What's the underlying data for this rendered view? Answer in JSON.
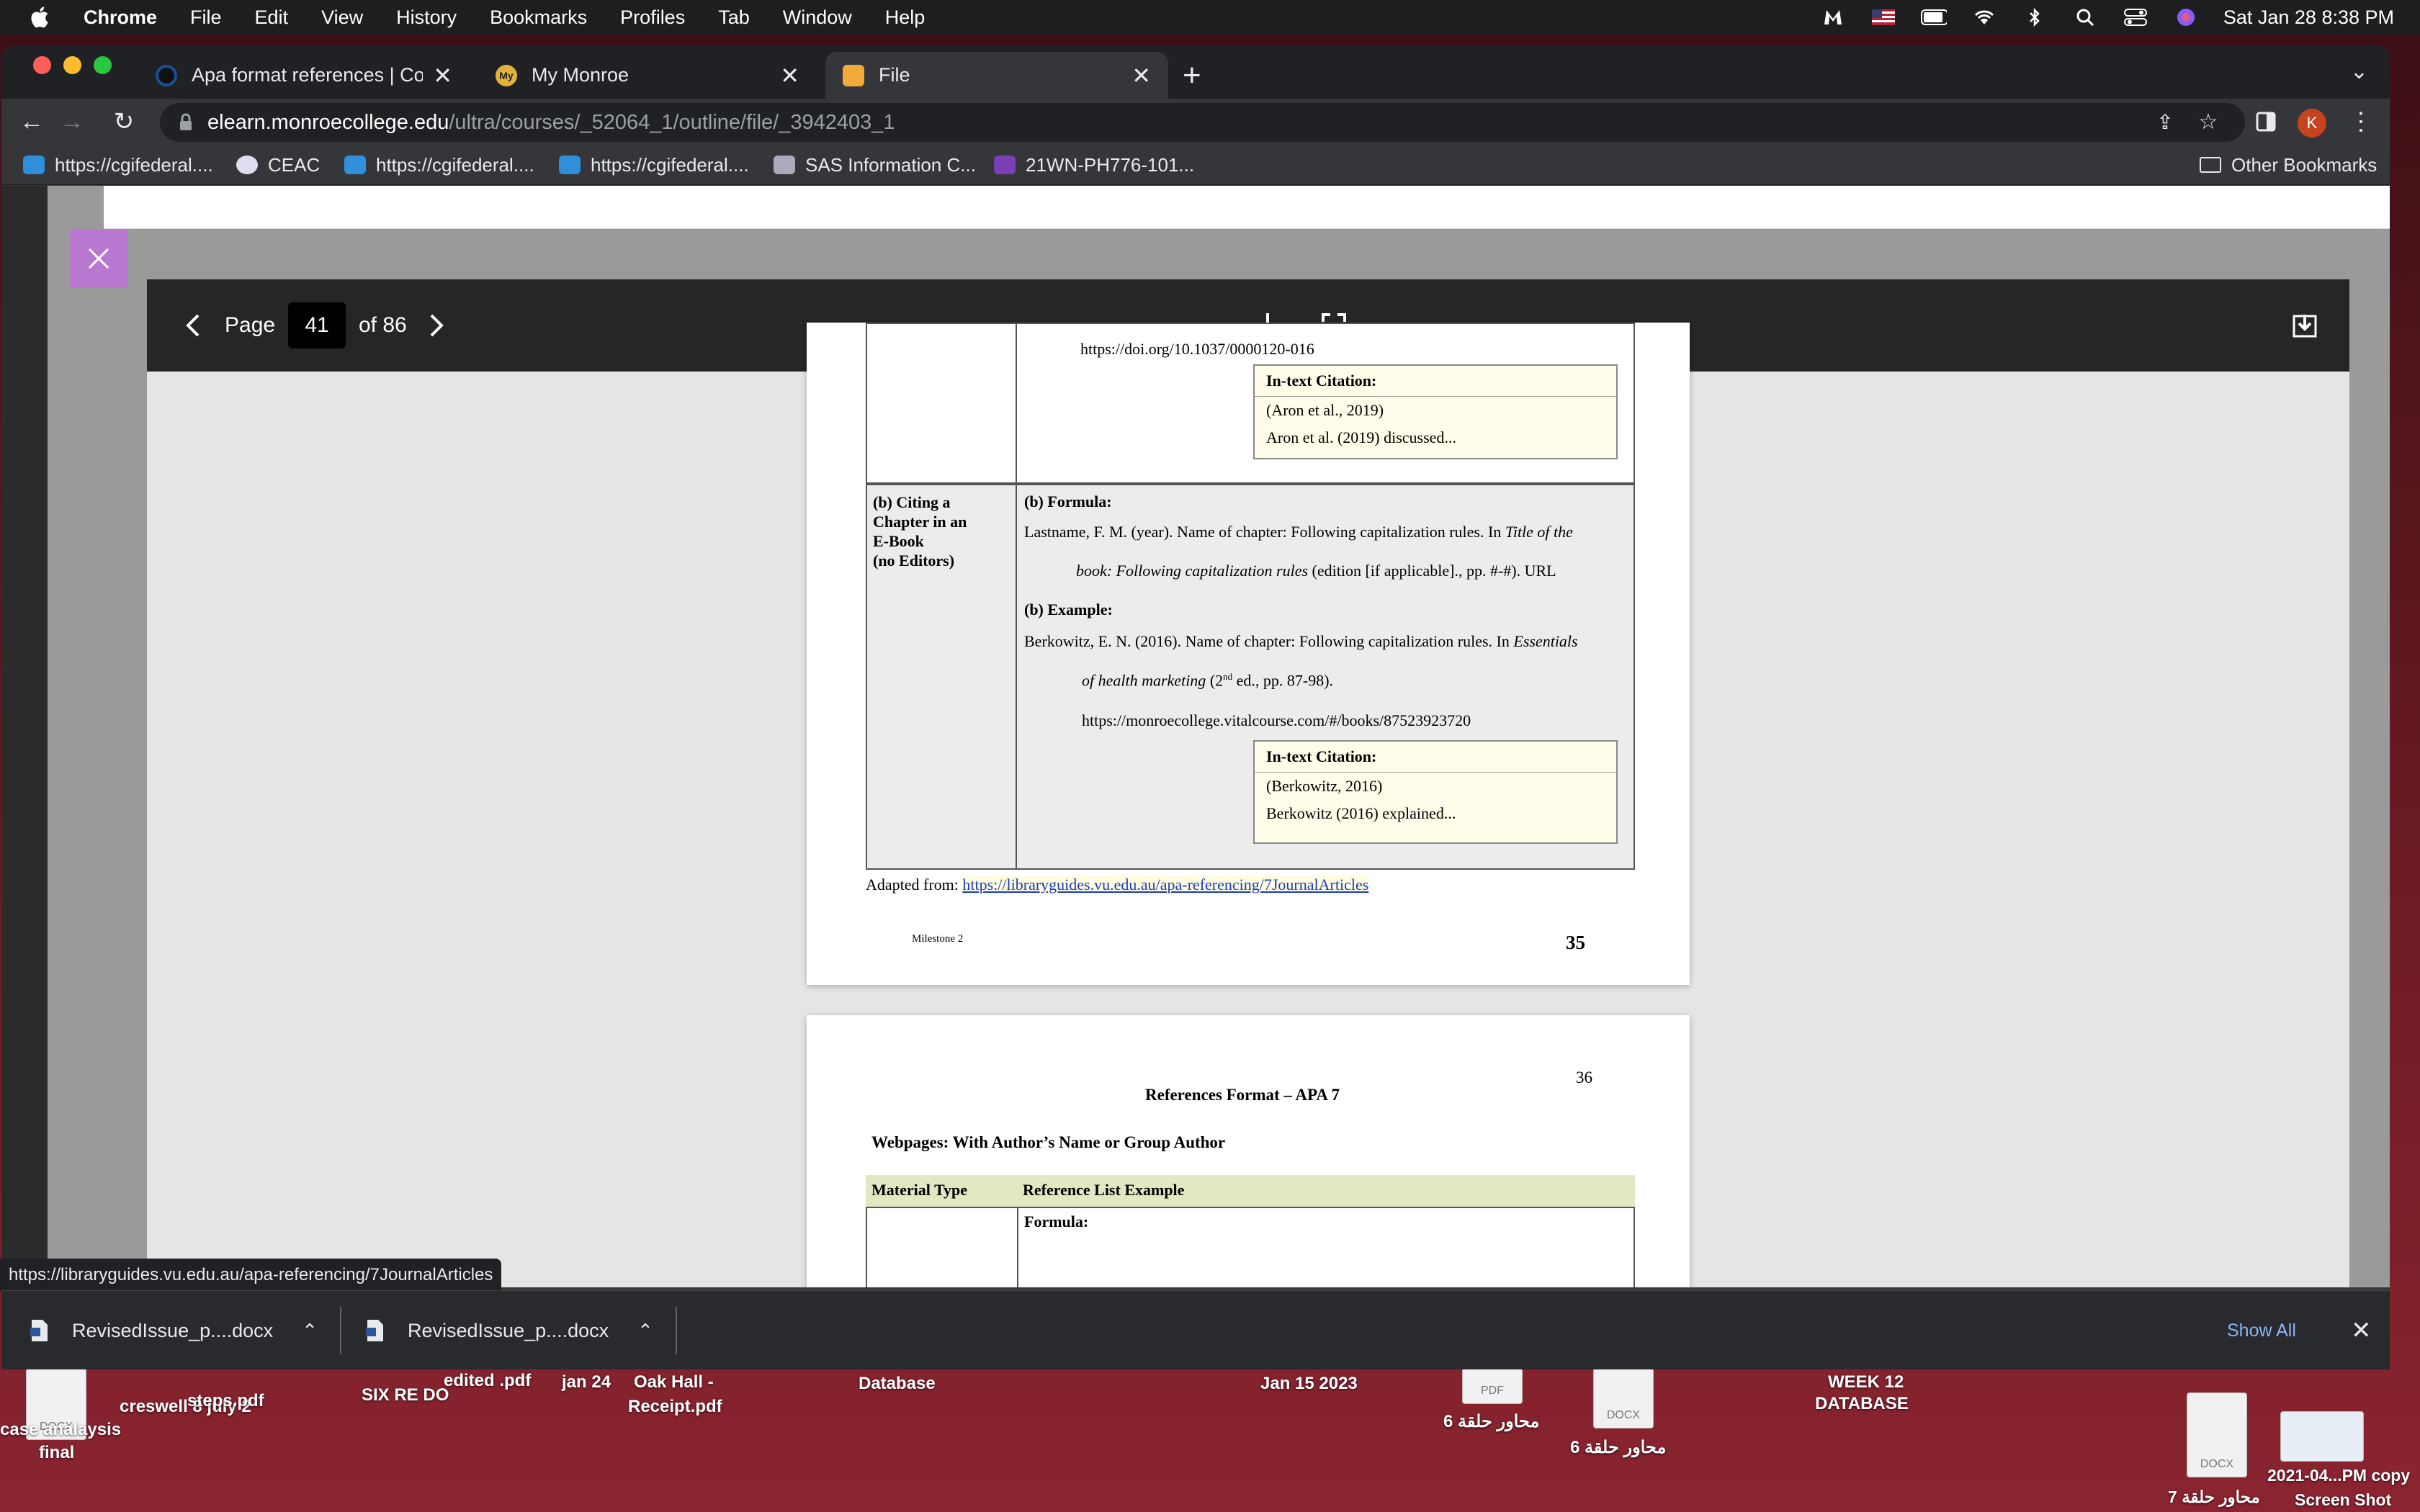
{
  "menubar": {
    "app": "Chrome",
    "items": [
      "File",
      "Edit",
      "View",
      "History",
      "Bookmarks",
      "Profiles",
      "Tab",
      "Window",
      "Help"
    ],
    "clock": "Sat Jan 28  8:38 PM"
  },
  "tabs": [
    {
      "title": "Apa format references | Compu",
      "icon": "circle-icon"
    },
    {
      "title": "My Monroe",
      "icon": "my-monroe-icon",
      "favicon_text": "My"
    },
    {
      "title": "File",
      "icon": "pencil-icon",
      "active": true
    }
  ],
  "address": {
    "host": "elearn.monroecollege.edu",
    "path": "/ultra/courses/_52064_1/outline/file/_3942403_1",
    "profile_initial": "K"
  },
  "bookmarks": [
    {
      "label": "https://cgifederal....",
      "icon": "cloud-icon"
    },
    {
      "label": "CEAC",
      "icon": "seal-icon"
    },
    {
      "label": "https://cgifederal....",
      "icon": "cloud-icon"
    },
    {
      "label": "https://cgifederal....",
      "icon": "cloud-icon"
    },
    {
      "label": "SAS Information C...",
      "icon": "sas-icon"
    },
    {
      "label": "21WN-PH776-101...",
      "icon": "course-icon"
    }
  ],
  "other_bookmarks": "Other Bookmarks",
  "viewer": {
    "page_label": "Page",
    "page_current": "41",
    "page_total": "of 86"
  },
  "pdf_page1": {
    "doi_line": "https://doi.org/10.1037/0000120-016",
    "cite_a": {
      "header": "In-text Citation:",
      "line1": "(Aron et al., 2019)",
      "line2": "Aron et al. (2019) discussed..."
    },
    "row_label_lines": [
      "(b) Citing a",
      "Chapter in an",
      "E-Book",
      "(no Editors)"
    ],
    "formula_heading": "(b) Formula:",
    "formula_line1": "Lastname, F. M. (year). Name of chapter: Following capitalization rules. In ",
    "formula_line1_italic": "Title of the",
    "formula_line2_italic": "book: Following capitalization rules",
    "formula_line2_rest": " (edition [if applicable]., pp. #-#). URL",
    "example_heading": "(b) Example:",
    "example_line1": "Berkowitz, E. N. (2016). Name of chapter: Following capitalization rules. In ",
    "example_line1_italic": "Essentials",
    "example_line2_italic": "of health marketing",
    "example_line2_pre": " (2",
    "example_line2_sup": "nd",
    "example_line2_rest": " ed., pp. 87-98).",
    "example_url": "https://monroecollege.vitalcourse.com/#/books/87523923720",
    "cite_b": {
      "header": "In-text Citation:",
      "line1": "(Berkowitz, 2016)",
      "line2": "Berkowitz (2016) explained..."
    },
    "adapted_label": "Adapted from: ",
    "adapted_link": "https://libraryguides.vu.edu.au/apa-referencing/7JournalArticles",
    "footer_left": "Milestone 2",
    "page_number": "35"
  },
  "pdf_page2": {
    "page_number": "36",
    "title": "References Format – APA 7",
    "subtitle": "Webpages: With Author’s Name or Group Author",
    "col1": "Material Type",
    "col2": "Reference List Example",
    "formula": "Formula:"
  },
  "status_url": "https://libraryguides.vu.edu.au/apa-referencing/7JournalArticles",
  "downloads": [
    {
      "name": "RevisedIssue_p....docx"
    },
    {
      "name": "RevisedIssue_p....docx"
    }
  ],
  "show_all": "Show All",
  "desktop_items": [
    {
      "label": "case analaysis"
    },
    {
      "label": "final"
    },
    {
      "label": "creswell 8 july 2"
    },
    {
      "label": "SIX RE DO"
    },
    {
      "label": "jan 24"
    },
    {
      "label": "Oak Hall -"
    },
    {
      "label": "Receipt.pdf"
    },
    {
      "label": "Database"
    },
    {
      "label": "Jan 15 2023"
    },
    {
      "label": "محاور حلقة 6"
    },
    {
      "label": "محاور حلقة 6"
    },
    {
      "label": "WEEK 12"
    },
    {
      "label": "DATABASE"
    },
    {
      "label": "2021-04...PM copy"
    },
    {
      "label": "Screen Shot"
    },
    {
      "label": "محاور حلقة 7"
    },
    {
      "label": "DOCX"
    },
    {
      "label": "PDF"
    },
    {
      "label": "edited .pdf"
    },
    {
      "label": "steps.pdf"
    }
  ],
  "colors": {
    "chrome_dark": "#202124",
    "chrome_toolbar": "#35363a",
    "viewer_bar": "#262626",
    "close_panel": "#b978d0",
    "link_blue": "#8ab4f8",
    "table_header": "#e3e8c2",
    "citation_box": "#fffde9"
  }
}
